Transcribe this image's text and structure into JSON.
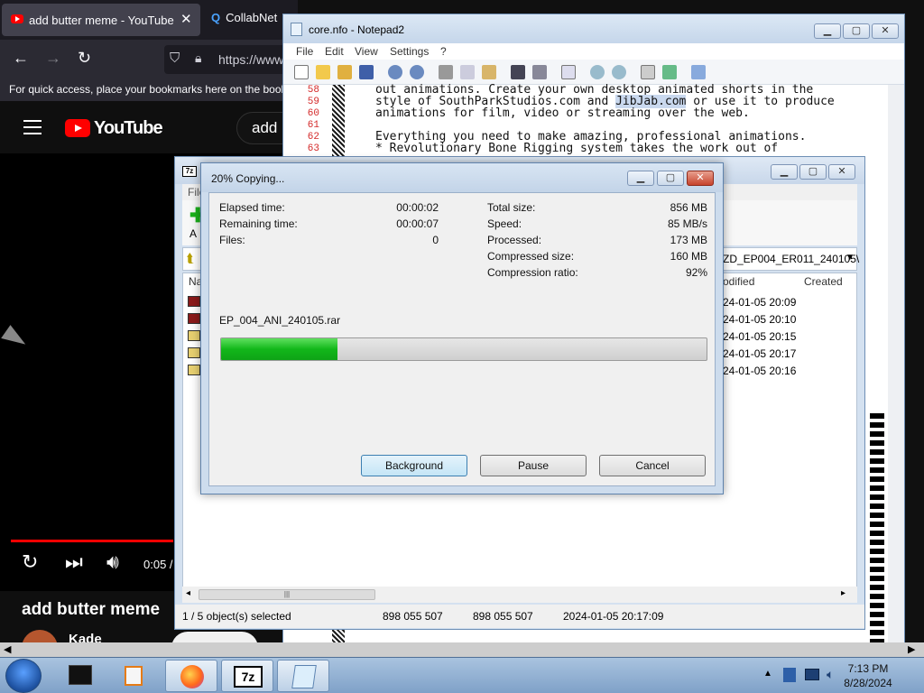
{
  "browser": {
    "active_tab_title": "add butter meme - YouTube",
    "tab2_title": "CollabNet",
    "tab_close": "✕",
    "url": "https://www",
    "bookmarks_hint": "For quick access, place your bookmarks here on the book",
    "youtube_logo": "YouTube",
    "search_value": "add b",
    "video_time": "0:05 /",
    "video_title": "add butter meme",
    "channel": "Kade"
  },
  "notepad": {
    "title": "core.nfo - Notepad2",
    "menu": [
      "File",
      "Edit",
      "View",
      "Settings",
      "?"
    ],
    "line_numbers": [
      "58",
      "59",
      "60",
      "61",
      "62",
      "63"
    ],
    "lines": [
      "out animations. Create your own desktop animated shorts in the",
      "style of SouthParkStudios.com and ",
      "animations for film, video or streaming over the web.",
      "",
      "Everything you need to make amazing, professional animations.",
      "* Revolutionary Bone Rigging system takes the work out of"
    ],
    "highlight": "JibJab.com",
    "line59_tail": " or use it to produce"
  },
  "fm": {
    "icon_text": "7z",
    "menu_first": "File",
    "add_label": "A",
    "path": "ZD_EP004_ER011_240105\\",
    "col_name": "Na",
    "col_modified": "odified",
    "col_created": "Created",
    "rows": [
      {
        "date": "24-01-05 20:09",
        "color": "#8b1a1a"
      },
      {
        "date": "24-01-05 20:10",
        "color": "#8b1a1a"
      },
      {
        "date": "24-01-05 20:15",
        "color": "#e8d070"
      },
      {
        "date": "24-01-05 20:17",
        "color": "#e8d070"
      },
      {
        "date": "24-01-05 20:16",
        "color": "#e8d070"
      }
    ],
    "status_selected": "1 / 5 object(s) selected",
    "status_size1": "898 055 507",
    "status_size2": "898 055 507",
    "status_date": "2024-01-05 20:17:09",
    "scroll_grip": "|||"
  },
  "dialog": {
    "title": "20% Copying...",
    "elapsed_label": "Elapsed time:",
    "elapsed_value": "00:00:02",
    "remaining_label": "Remaining time:",
    "remaining_value": "00:00:07",
    "files_label": "Files:",
    "files_value": "0",
    "total_label": "Total size:",
    "total_value": "856 MB",
    "speed_label": "Speed:",
    "speed_value": "85 MB/s",
    "processed_label": "Processed:",
    "processed_value": "173 MB",
    "compressed_label": "Compressed size:",
    "compressed_value": "160 MB",
    "ratio_label": "Compression ratio:",
    "ratio_value": "92%",
    "filename": "EP_004_ANI_240105.rar",
    "progress_fraction": 0.24,
    "btn_background": "Background",
    "btn_pause": "Pause",
    "btn_cancel": "Cancel"
  },
  "taskbar": {
    "time": "7:13 PM",
    "date": "8/28/2024",
    "sevenzip_label": "7z"
  },
  "colors": {
    "progress_green": "#12b71a",
    "youtube_red": "#ff0000",
    "line_number_red": "#d42a2a"
  }
}
